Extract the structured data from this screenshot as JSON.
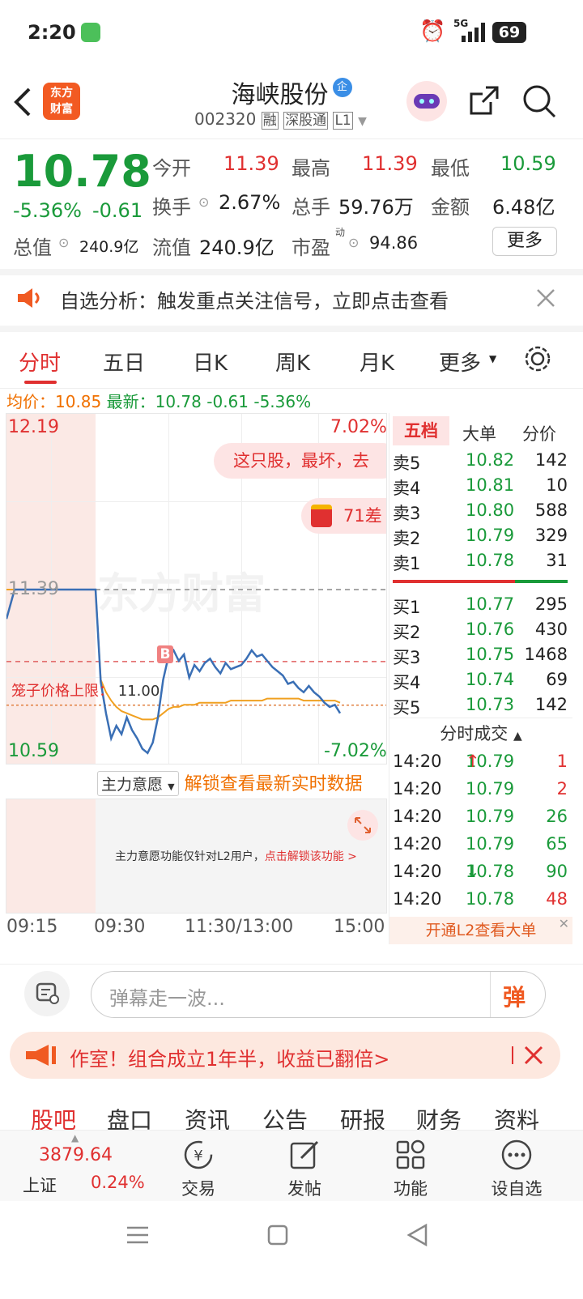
{
  "status_bar": {
    "time": "2:20",
    "network": "5G",
    "battery": "69"
  },
  "header": {
    "title": "海峡股份",
    "title_badge": "企",
    "code": "002320",
    "tags": [
      "融",
      "深股通",
      "L1"
    ],
    "logo_line1": "东方",
    "logo_line2": "财富"
  },
  "quote": {
    "price": "10.78",
    "change_pct": "-5.36%",
    "change": "-0.61",
    "stats": [
      {
        "label": "今开",
        "value": "11.39",
        "color": "red"
      },
      {
        "label": "最高",
        "value": "11.39",
        "color": "red"
      },
      {
        "label": "最低",
        "value": "10.59",
        "color": "green"
      },
      {
        "label": "换手",
        "value": "2.67%",
        "color": "dark"
      },
      {
        "label": "总手",
        "value": "59.76万",
        "color": "dark"
      },
      {
        "label": "金额",
        "value": "6.48亿",
        "color": "dark"
      }
    ],
    "total_value_label": "总值",
    "total_value": "240.9亿",
    "float_value_label": "流值",
    "float_value": "240.9亿",
    "pe_label": "市盈",
    "pe_sup": "动",
    "pe_value": "94.86",
    "more_label": "更多"
  },
  "notice": {
    "text": "自选分析：触发重点关注信号，立即点击查看"
  },
  "tabs": [
    "分时",
    "五日",
    "日K",
    "周K",
    "月K",
    "更多"
  ],
  "active_tab": "分时",
  "avg_line": {
    "avg_label": "均价：",
    "avg_value": "10.85",
    "latest_label": "最新：",
    "latest_value": "10.78",
    "change": "-0.61",
    "change_pct": "-5.36%"
  },
  "chart_data": {
    "type": "line",
    "y_max_label": "12.19",
    "y_max_pct": "7.02%",
    "y_min_label": "10.59",
    "y_min_pct": "-7.02%",
    "prev_close_label": "11.39",
    "cage_label": "笼子价格上限：",
    "cage_value": "11.00",
    "watermark": "东方财富",
    "promo_bubble": "这只股，最坏，去",
    "promo_bubble2": "71差",
    "marker": "B",
    "price_series": [
      11.25,
      11.39,
      11.39,
      11.39,
      11.39,
      11.39,
      11.39,
      11.39,
      11.39,
      11.39,
      11.39,
      11.39,
      10.95,
      10.8,
      10.68,
      10.74,
      10.7,
      10.78,
      10.72,
      10.68,
      10.63,
      10.61,
      10.66,
      10.78,
      10.96,
      11.07,
      11.1,
      11.05,
      11.08,
      10.97,
      11.03,
      11.0,
      11.04,
      11.06,
      11.02,
      10.99,
      11.04,
      11.01,
      11.02,
      11.03,
      11.06,
      11.1,
      11.07,
      11.08,
      11.05,
      11.02,
      11.0,
      10.98,
      10.94,
      10.95,
      10.92,
      10.9,
      10.93,
      10.9,
      10.88,
      10.85,
      10.83,
      10.84,
      10.8
    ],
    "avg_series": [
      11.39,
      11.39,
      11.39,
      11.39,
      11.39,
      11.39,
      11.39,
      11.39,
      11.39,
      11.39,
      11.39,
      11.39,
      10.96,
      10.9,
      10.86,
      10.83,
      10.81,
      10.8,
      10.79,
      10.78,
      10.77,
      10.77,
      10.77,
      10.78,
      10.8,
      10.82,
      10.83,
      10.83,
      10.84,
      10.84,
      10.84,
      10.85,
      10.85,
      10.85,
      10.85,
      10.85,
      10.85,
      10.86,
      10.86,
      10.86,
      10.86,
      10.86,
      10.86,
      10.86,
      10.87,
      10.87,
      10.87,
      10.87,
      10.87,
      10.87,
      10.87,
      10.86,
      10.86,
      10.86,
      10.86,
      10.86,
      10.86,
      10.86,
      10.85
    ],
    "ylim": [
      10.59,
      12.19
    ],
    "x_labels": [
      "09:15",
      "09:30",
      "11:30/13:00",
      "15:00"
    ]
  },
  "indicator": {
    "selector": "主力意愿",
    "unlock": "解锁查看最新实时数据",
    "panel_text": "主力意愿功能仅针对L2用户，",
    "panel_link": "点击解锁该功能 >"
  },
  "orderbook": {
    "tabs": [
      "五档",
      "大单",
      "分价"
    ],
    "asks": [
      {
        "label": "卖5",
        "price": "10.82",
        "vol": "142"
      },
      {
        "label": "卖4",
        "price": "10.81",
        "vol": "10"
      },
      {
        "label": "卖3",
        "price": "10.80",
        "vol": "588"
      },
      {
        "label": "卖2",
        "price": "10.79",
        "vol": "329"
      },
      {
        "label": "卖1",
        "price": "10.78",
        "vol": "31"
      }
    ],
    "bids": [
      {
        "label": "买1",
        "price": "10.77",
        "vol": "295"
      },
      {
        "label": "买2",
        "price": "10.76",
        "vol": "430"
      },
      {
        "label": "买3",
        "price": "10.75",
        "vol": "1468"
      },
      {
        "label": "买4",
        "price": "10.74",
        "vol": "69"
      },
      {
        "label": "买5",
        "price": "10.73",
        "vol": "142"
      }
    ],
    "trades_title": "分时成交",
    "trades": [
      {
        "time": "14:20",
        "price": "10.79",
        "dir": "↑",
        "vol": "1",
        "color": "red"
      },
      {
        "time": "14:20",
        "price": "10.79",
        "dir": "",
        "vol": "2",
        "color": "red"
      },
      {
        "time": "14:20",
        "price": "10.79",
        "dir": "",
        "vol": "26",
        "color": "green"
      },
      {
        "time": "14:20",
        "price": "10.79",
        "dir": "",
        "vol": "65",
        "color": "green"
      },
      {
        "time": "14:20",
        "price": "10.78",
        "dir": "↓",
        "vol": "90",
        "color": "green"
      },
      {
        "time": "14:20",
        "price": "10.78",
        "dir": "",
        "vol": "48",
        "color": "red"
      }
    ],
    "l2_link": "开通L2查看大单"
  },
  "danmaku": {
    "placeholder": "弹幕走一波...",
    "send": "弹"
  },
  "promo": {
    "text": "作室！组合成立1年半，收益已翻倍>"
  },
  "subtabs": [
    "股吧",
    "盘口",
    "资讯",
    "公告",
    "研报",
    "财务",
    "资料"
  ],
  "bottom": {
    "index_value": "3879.64",
    "index_name": "上证",
    "index_change": "0.24%",
    "items": [
      "交易",
      "发帖",
      "功能",
      "设自选"
    ]
  }
}
